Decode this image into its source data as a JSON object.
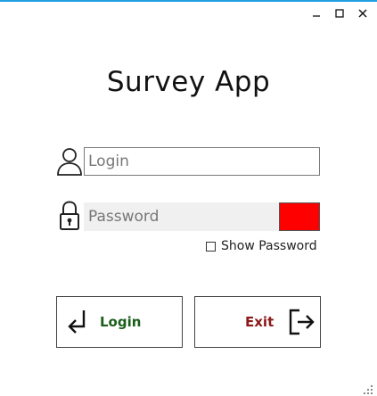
{
  "window": {
    "accent_color": "#1e9fe0",
    "controls": {
      "minimize_icon": "minimize-icon",
      "maximize_icon": "maximize-icon",
      "close_icon": "close-icon"
    }
  },
  "header": {
    "title": "Survey App"
  },
  "form": {
    "login": {
      "icon": "user-icon",
      "placeholder": "Login",
      "value": ""
    },
    "password": {
      "icon": "lock-icon",
      "placeholder": "Password",
      "value": "",
      "error_indicator_color": "#ff0000"
    },
    "show_password": {
      "label": "Show Password",
      "checked": false
    }
  },
  "actions": {
    "login": {
      "label": "Login",
      "icon": "enter-arrow-icon",
      "color": "#1a5e1a"
    },
    "exit": {
      "label": "Exit",
      "icon": "exit-door-icon",
      "color": "#8b1a1a"
    }
  }
}
